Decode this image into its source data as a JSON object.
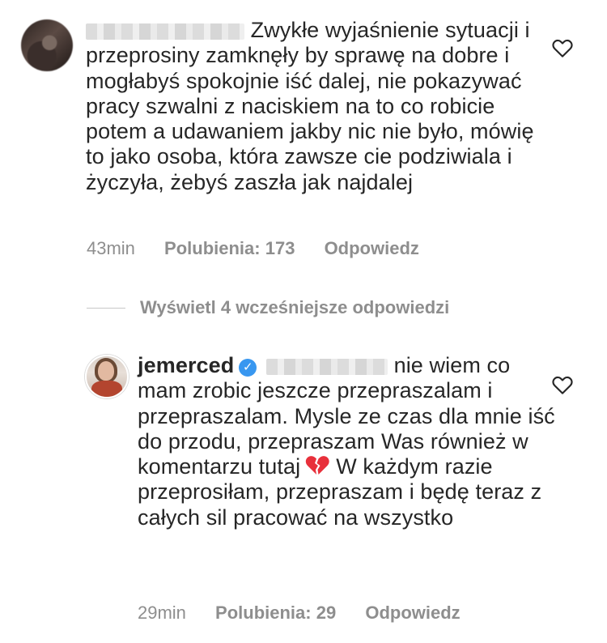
{
  "comment1": {
    "text": "Zwykłe wyjaśnienie sytuacji i przeprosiny zamknęły by sprawę na dobre i mogłabyś spokojnie iść dalej, nie pokazywać pracy szwalni z naciskiem na to co robicie potem a udawaniem jakby nic nie było, mówię to jako osoba, która zawsze cie podziwiala i życzyła, żebyś zaszła jak najdalej",
    "time": "43min",
    "likes": "Polubienia: 173",
    "reply": "Odpowiedz",
    "like_icon": "heart-outline-icon"
  },
  "view_replies": "Wyświetl 4 wcześniejsze odpowiedzi",
  "comment2": {
    "username": "jemerced",
    "verified_icon": "verified-badge-icon",
    "text_before_emoji": "nie wiem co mam zrobic jeszcze przepraszalam i przepraszalam. Mysle ze czas dla mnie iść do przodu, przepraszam Was również w komentarzu tutaj",
    "emoji": "broken-heart-emoji",
    "text_after_emoji": "W każdym razie przeprosiłam, przepraszam i będę teraz z całych sil pracować na wszystko",
    "time": "29min",
    "likes": "Polubienia: 29",
    "reply": "Odpowiedz",
    "like_icon": "heart-outline-icon"
  },
  "colors": {
    "text": "#262626",
    "meta": "#8e8e8e",
    "verified": "#3897f0",
    "broken_heart": "#e8303b"
  }
}
